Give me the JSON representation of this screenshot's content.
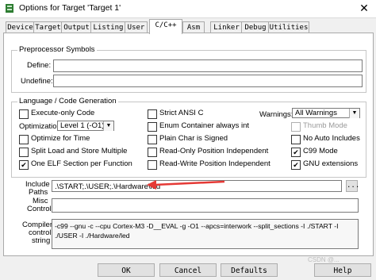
{
  "window": {
    "title": "Options for Target 'Target 1'",
    "close_glyph": "✕"
  },
  "tabs": [
    {
      "label": "Device"
    },
    {
      "label": "Target"
    },
    {
      "label": "Output"
    },
    {
      "label": "Listing"
    },
    {
      "label": "User"
    },
    {
      "label": "C/C++"
    },
    {
      "label": "Asm"
    },
    {
      "label": "Linker"
    },
    {
      "label": "Debug"
    },
    {
      "label": "Utilities"
    }
  ],
  "preprocessor": {
    "group_title": "Preprocessor Symbols",
    "define_label": "Define:",
    "define_value": "",
    "undefine_label": "Undefine:",
    "undefine_value": ""
  },
  "language": {
    "group_title": "Language / Code Generation",
    "execute_only": {
      "label": "Execute-only Code",
      "checked": false
    },
    "optimization": {
      "label": "Optimization:",
      "value": "Level 1 (-O1)"
    },
    "optimize_time": {
      "label": "Optimize for Time",
      "checked": false
    },
    "split_load": {
      "label": "Split Load and Store Multiple",
      "checked": false
    },
    "one_elf": {
      "label": "One ELF Section per Function",
      "checked": true
    },
    "strict_ansi": {
      "label": "Strict ANSI C",
      "checked": false
    },
    "enum_container": {
      "label": "Enum Container always int",
      "checked": false
    },
    "plain_char": {
      "label": "Plain Char is Signed",
      "checked": false
    },
    "ro_pi": {
      "label": "Read-Only Position Independent",
      "checked": false
    },
    "rw_pi": {
      "label": "Read-Write Position Independent",
      "checked": false
    },
    "warnings": {
      "label": "Warnings:",
      "value": "All Warnings"
    },
    "thumb_mode": {
      "label": "Thumb Mode",
      "checked": false,
      "disabled": true
    },
    "no_auto_includes": {
      "label": "No Auto Includes",
      "checked": false
    },
    "c99_mode": {
      "label": "C99 Mode",
      "checked": true
    },
    "gnu_ext": {
      "label": "GNU extensions",
      "checked": true
    }
  },
  "include_paths": {
    "label_1": "Include",
    "label_2": "Paths",
    "value": ".\\START;.\\USER;.\\Hardware\\led",
    "browse": "..."
  },
  "misc_controls": {
    "label_1": "Misc",
    "label_2": "Controls",
    "value": ""
  },
  "compiler_string": {
    "label_1": "Compiler",
    "label_2": "control",
    "label_3": "string",
    "line_1": "-c99 --gnu -c --cpu Cortex-M3 -D__EVAL -g -O1 --apcs=interwork --split_sections -I ./START -I",
    "line_2": "./USER -I ./Hardware/led"
  },
  "buttons": {
    "ok": "OK",
    "cancel": "Cancel",
    "defaults": "Defaults",
    "help": "Help"
  },
  "watermark": "CSDN @..."
}
